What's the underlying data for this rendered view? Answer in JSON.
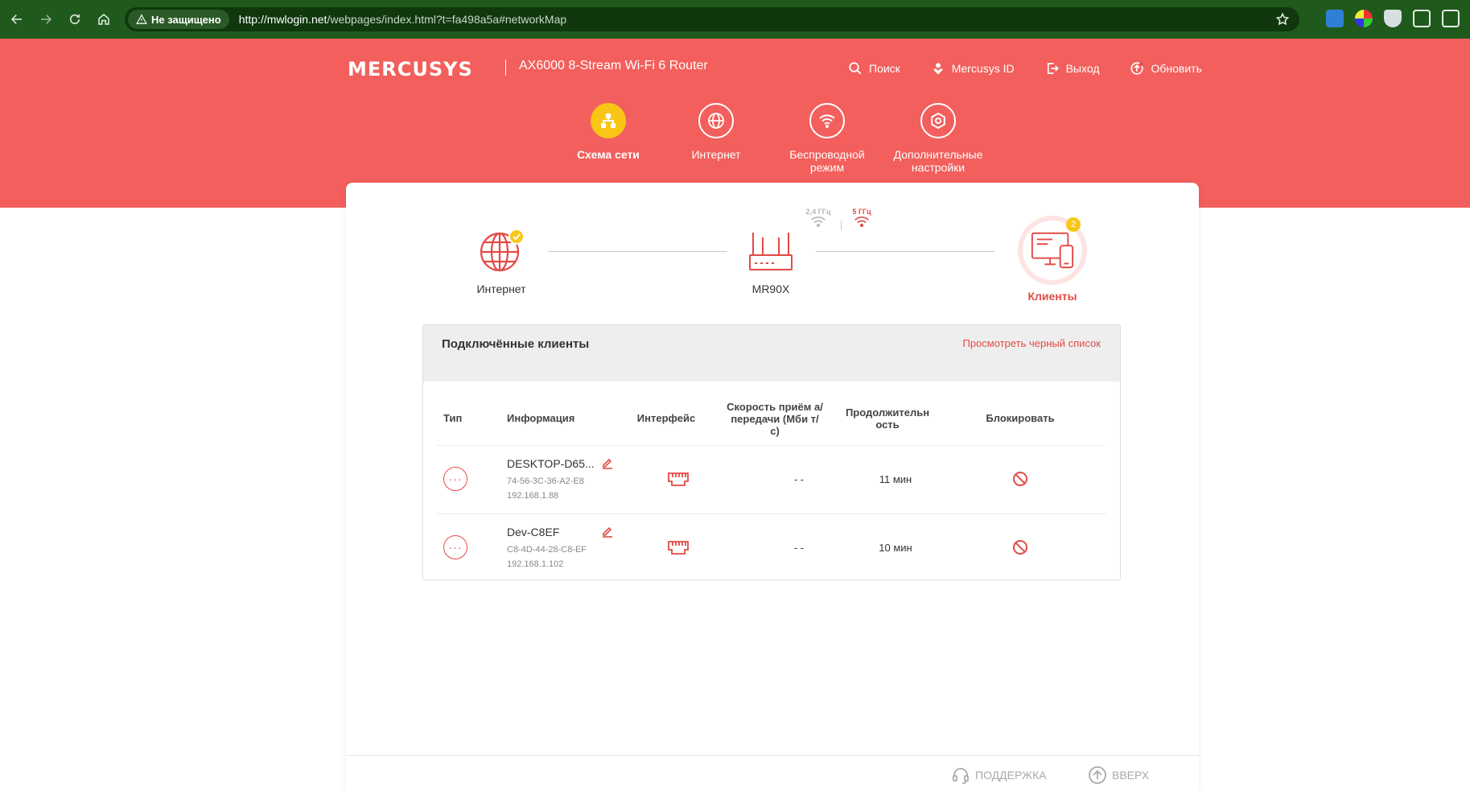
{
  "browser": {
    "security_label": "Не защищено",
    "url_host": "http://mwlogin.net",
    "url_path": "/webpages/index.html?t=fa498a5a#networkMap"
  },
  "header": {
    "brand": "MERCUSYS",
    "model": "AX6000 8-Stream Wi-Fi 6 Router",
    "links": {
      "search": "Поиск",
      "account": "Mercusys ID",
      "logout": "Выход",
      "update": "Обновить"
    }
  },
  "tabs": [
    {
      "label": "Схема сети",
      "active": true
    },
    {
      "label": "Интернет"
    },
    {
      "label": "Беспроводной режим"
    },
    {
      "label": "Дополнительные настройки"
    }
  ],
  "topology": {
    "internet_label": "Интернет",
    "router_label": "MR90X",
    "clients_label": "Клиенты",
    "clients_count": "2",
    "band_24": "2,4 ГГц",
    "band_5": "5 ГГц"
  },
  "clients_panel": {
    "title": "Подключённые клиенты",
    "blacklist_link": "Просмотреть черный список",
    "columns": {
      "type": "Тип",
      "info": "Информация",
      "iface": "Интерфейс",
      "speed": "Скорость приём а/передачи (Мби т/с)",
      "duration": "Продолжительн ость",
      "block": "Блокировать"
    },
    "rows": [
      {
        "name": "DESKTOP-D65...",
        "mac": "74-56-3C-36-A2-E8",
        "ip": "192.168.1.88",
        "speed": "- -",
        "duration": "11 мин"
      },
      {
        "name": "Dev-C8EF",
        "mac": "C8-4D-44-28-C8-EF",
        "ip": "192.168.1.102",
        "speed": "- -",
        "duration": "10 мин"
      }
    ]
  },
  "footer": {
    "support": "ПОДДЕРЖКА",
    "top": "ВВЕРХ"
  },
  "colors": {
    "brand_red": "#f25f5c",
    "accent_red": "#e34a46",
    "active_tab": "#f9c617",
    "browser_green": "#1f5a1c"
  }
}
